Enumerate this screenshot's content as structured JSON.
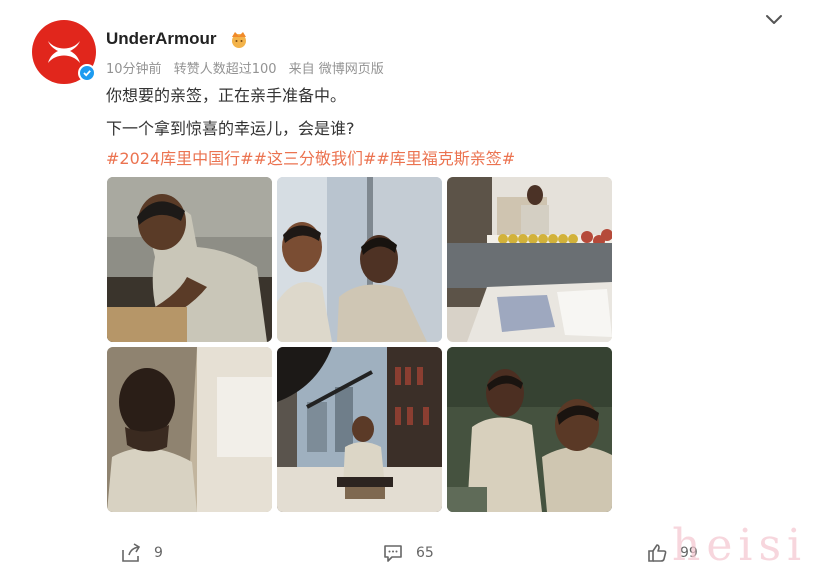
{
  "post": {
    "username": "UnderArmour",
    "time": "10分钟前",
    "reposts_info": "转赞人数超过100",
    "source": "来自 微博网页版",
    "text_line1": "你想要的亲签，正在亲手准备中。",
    "text_line2": "下一个拿到惊喜的幸运儿，会是谁?",
    "hashtags": "#2024库里中国行##这三分敬我们##库里福克斯亲签#"
  },
  "icons": {
    "avatar": "under-armour-logo",
    "verified": "verified-badge-icon",
    "crown": "crown-icon",
    "more": "chevron-down-icon",
    "repost": "share-icon",
    "comment": "comment-icon",
    "like": "thumbs-up-icon"
  },
  "colors": {
    "brand_red": "#e1261c",
    "hashtag": "#eb7350",
    "verified": "#1d9bf0",
    "meta_gray": "#939393"
  },
  "footer": {
    "repost_count": "9",
    "comment_count": "65",
    "like_count": "99"
  },
  "watermark": "heisi"
}
